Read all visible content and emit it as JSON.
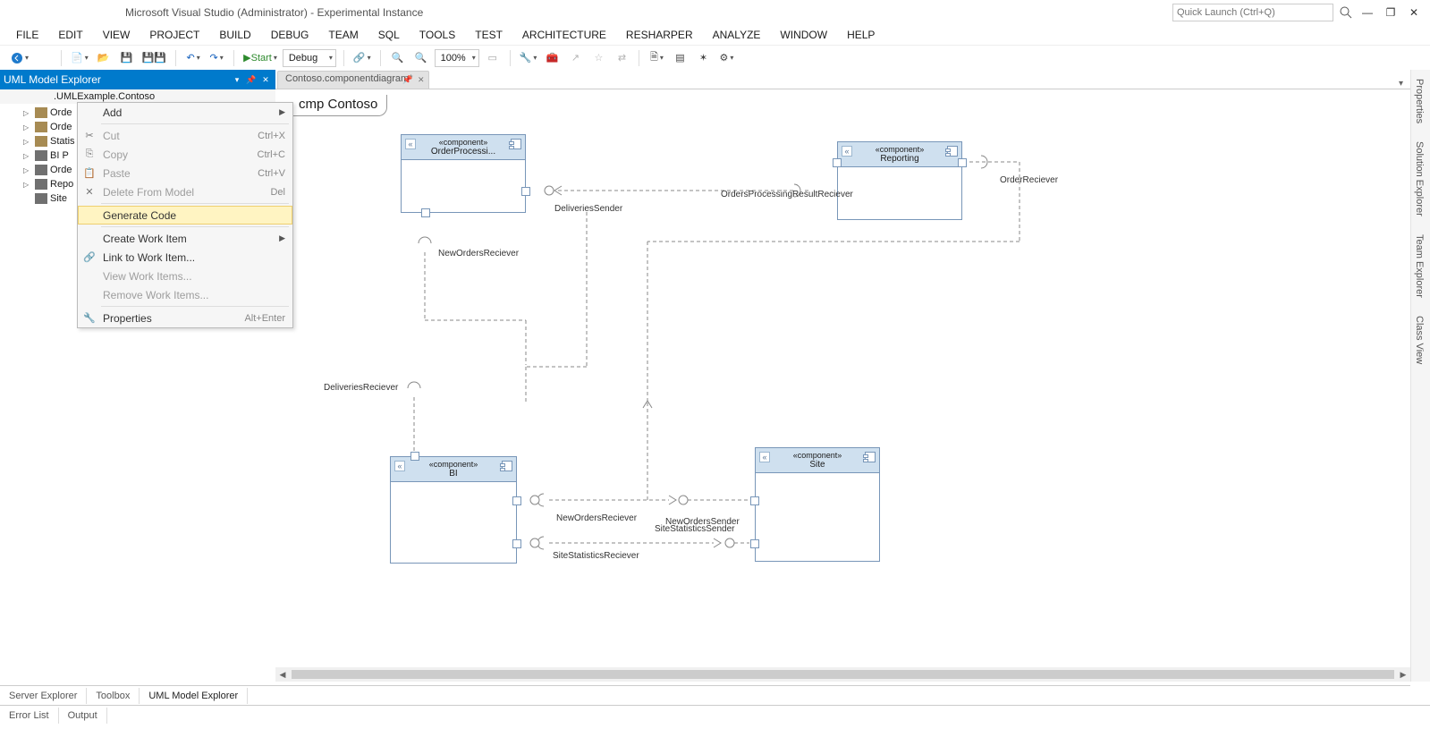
{
  "window": {
    "title": "Microsoft Visual Studio (Administrator) - Experimental Instance",
    "quick_launch_placeholder": "Quick Launch (Ctrl+Q)"
  },
  "menubar": [
    "FILE",
    "EDIT",
    "VIEW",
    "PROJECT",
    "BUILD",
    "DEBUG",
    "TEAM",
    "SQL",
    "TOOLS",
    "TEST",
    "ARCHITECTURE",
    "RESHARPER",
    "ANALYZE",
    "WINDOW",
    "HELP"
  ],
  "toolbar": {
    "start_label": "Start",
    "config_label": "Debug",
    "zoom_label": "100%"
  },
  "panel": {
    "title": "UML Model Explorer",
    "breadcrumb": ".UMLExample.Contoso",
    "nodes": [
      {
        "icon": "pkg",
        "label": "Orde"
      },
      {
        "icon": "pkg",
        "label": "Orde"
      },
      {
        "icon": "pkg",
        "label": "Statis"
      },
      {
        "icon": "fld",
        "label": "BI P"
      },
      {
        "icon": "fld",
        "label": "Orde"
      },
      {
        "icon": "fld",
        "label": "Repo"
      },
      {
        "icon": "fld",
        "label": "Site"
      }
    ]
  },
  "context_menu": [
    {
      "label": "Add",
      "submenu": true
    },
    {
      "sep": true
    },
    {
      "label": "Cut",
      "shortcut": "Ctrl+X",
      "disabled": true,
      "icon": "✂"
    },
    {
      "label": "Copy",
      "shortcut": "Ctrl+C",
      "disabled": true,
      "icon": "⎘"
    },
    {
      "label": "Paste",
      "shortcut": "Ctrl+V",
      "disabled": true,
      "icon": "📋"
    },
    {
      "label": "Delete From Model",
      "shortcut": "Del",
      "disabled": true,
      "icon": "✕"
    },
    {
      "sep": true
    },
    {
      "label": "Generate Code",
      "hover": true
    },
    {
      "sep": true
    },
    {
      "label": "Create Work Item",
      "submenu": true
    },
    {
      "label": "Link to Work Item...",
      "icon": "🔗"
    },
    {
      "label": "View Work Items...",
      "disabled": true
    },
    {
      "label": "Remove Work Items...",
      "disabled": true
    },
    {
      "sep": true
    },
    {
      "label": "Properties",
      "shortcut": "Alt+Enter",
      "icon": "🔧"
    }
  ],
  "document": {
    "tab_label": "Contoso.componentdiagram*",
    "diagram_title": "cmp Contoso",
    "components": {
      "order_processing": {
        "stereo": "«component»",
        "name": "OrderProcessi..."
      },
      "reporting": {
        "stereo": "«component»",
        "name": "Reporting"
      },
      "bi": {
        "stereo": "«component»",
        "name": "BI"
      },
      "site": {
        "stereo": "«component»",
        "name": "Site"
      }
    },
    "labels": {
      "deliveries_sender": "DeliveriesSender",
      "orders_processing_result_reciever": "OrdersProcessingResultReciever",
      "order_reciever": "OrderReciever",
      "new_orders_reciever_top": "NewOrdersReciever",
      "deliveries_reciever": "DeliveriesReciever",
      "new_orders_reciever_bottom": "NewOrdersReciever",
      "new_orders_sender": "NewOrdersSender",
      "site_statistics_sender": "SiteStatisticsSender",
      "site_statistics_reciever": "SiteStatisticsReciever"
    }
  },
  "right_tabs": [
    "Properties",
    "Solution Explorer",
    "Team Explorer",
    "Class View"
  ],
  "bottom_tabs_upper": [
    "Server Explorer",
    "Toolbox",
    "UML Model Explorer"
  ],
  "bottom_tabs_lower": [
    "Error List",
    "Output"
  ]
}
